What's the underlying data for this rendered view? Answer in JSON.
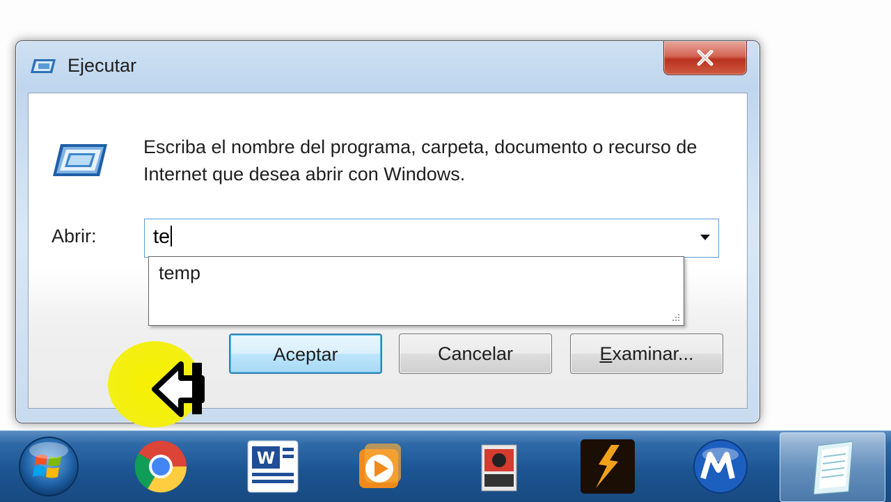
{
  "dialog": {
    "title": "Ejecutar",
    "close_label": "X",
    "description": "Escriba el nombre del programa, carpeta, documento o recurso de Internet que desea abrir con Windows.",
    "open_label": "Abrir:",
    "open_value": "te",
    "suggestions": [
      "temp"
    ],
    "buttons": {
      "ok": "Aceptar",
      "cancel": "Cancelar",
      "browse_first": "E",
      "browse_rest": "xaminar..."
    }
  },
  "taskbar": {
    "items": [
      {
        "icon": "windows-start-orb-icon"
      },
      {
        "icon": "chrome-icon"
      },
      {
        "icon": "word-icon"
      },
      {
        "icon": "media-player-icon"
      },
      {
        "icon": "game-icon"
      },
      {
        "icon": "resident-evil-5-icon"
      },
      {
        "icon": "m-app-icon"
      },
      {
        "icon": "notepad-icon"
      }
    ]
  },
  "colors": {
    "taskbar": "#1c5592",
    "close_button": "#c8432c",
    "highlight": "#f4ef10",
    "ok_border": "#3c7fb1"
  }
}
